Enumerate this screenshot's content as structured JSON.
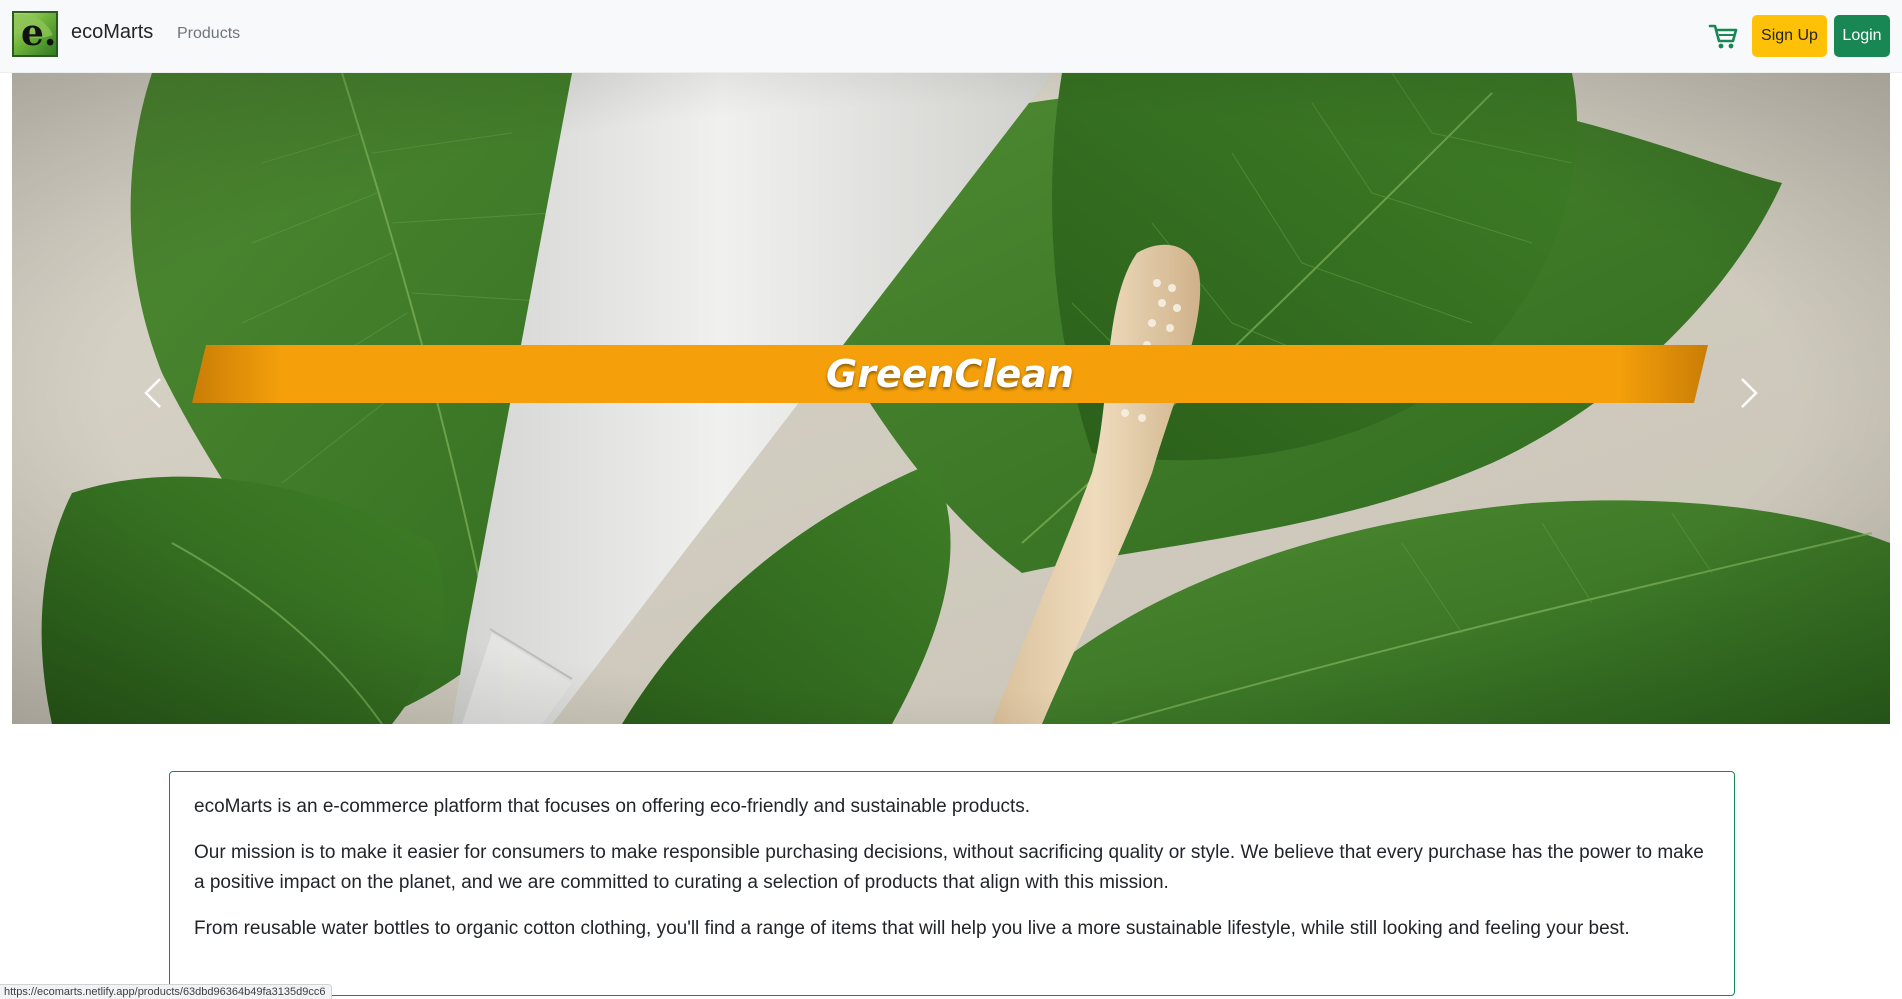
{
  "navbar": {
    "logo_letter": "e.",
    "brand": "ecoMarts",
    "products_link": "Products",
    "cart_icon": "shopping-cart-icon",
    "signup_label": "Sign Up",
    "login_label": "Login"
  },
  "hero": {
    "title": "GreenClean",
    "prev_icon": "chevron-left-icon",
    "next_icon": "chevron-right-icon",
    "banner_color": "#f5a00b"
  },
  "about": {
    "p1": "ecoMarts is an e-commerce platform that focuses on offering eco-friendly and sustainable products.",
    "p2": "Our mission is to make it easier for consumers to make responsible purchasing decisions, without sacrificing quality or style. We believe that every purchase has the power to make a positive impact on the planet, and we are committed to curating a selection of products that align with this mission.",
    "p3": "From reusable water bottles to organic cotton clothing, you'll find a range of items that will help you live a more sustainable lifestyle, while still looking and feeling your best."
  },
  "status_bar": {
    "url": "https://ecomarts.netlify.app/products/63dbd96364b49fa3135d9cc6"
  },
  "colors": {
    "accent_green": "#198754",
    "accent_yellow": "#ffc107",
    "navbar_bg": "#f8f9fa"
  }
}
